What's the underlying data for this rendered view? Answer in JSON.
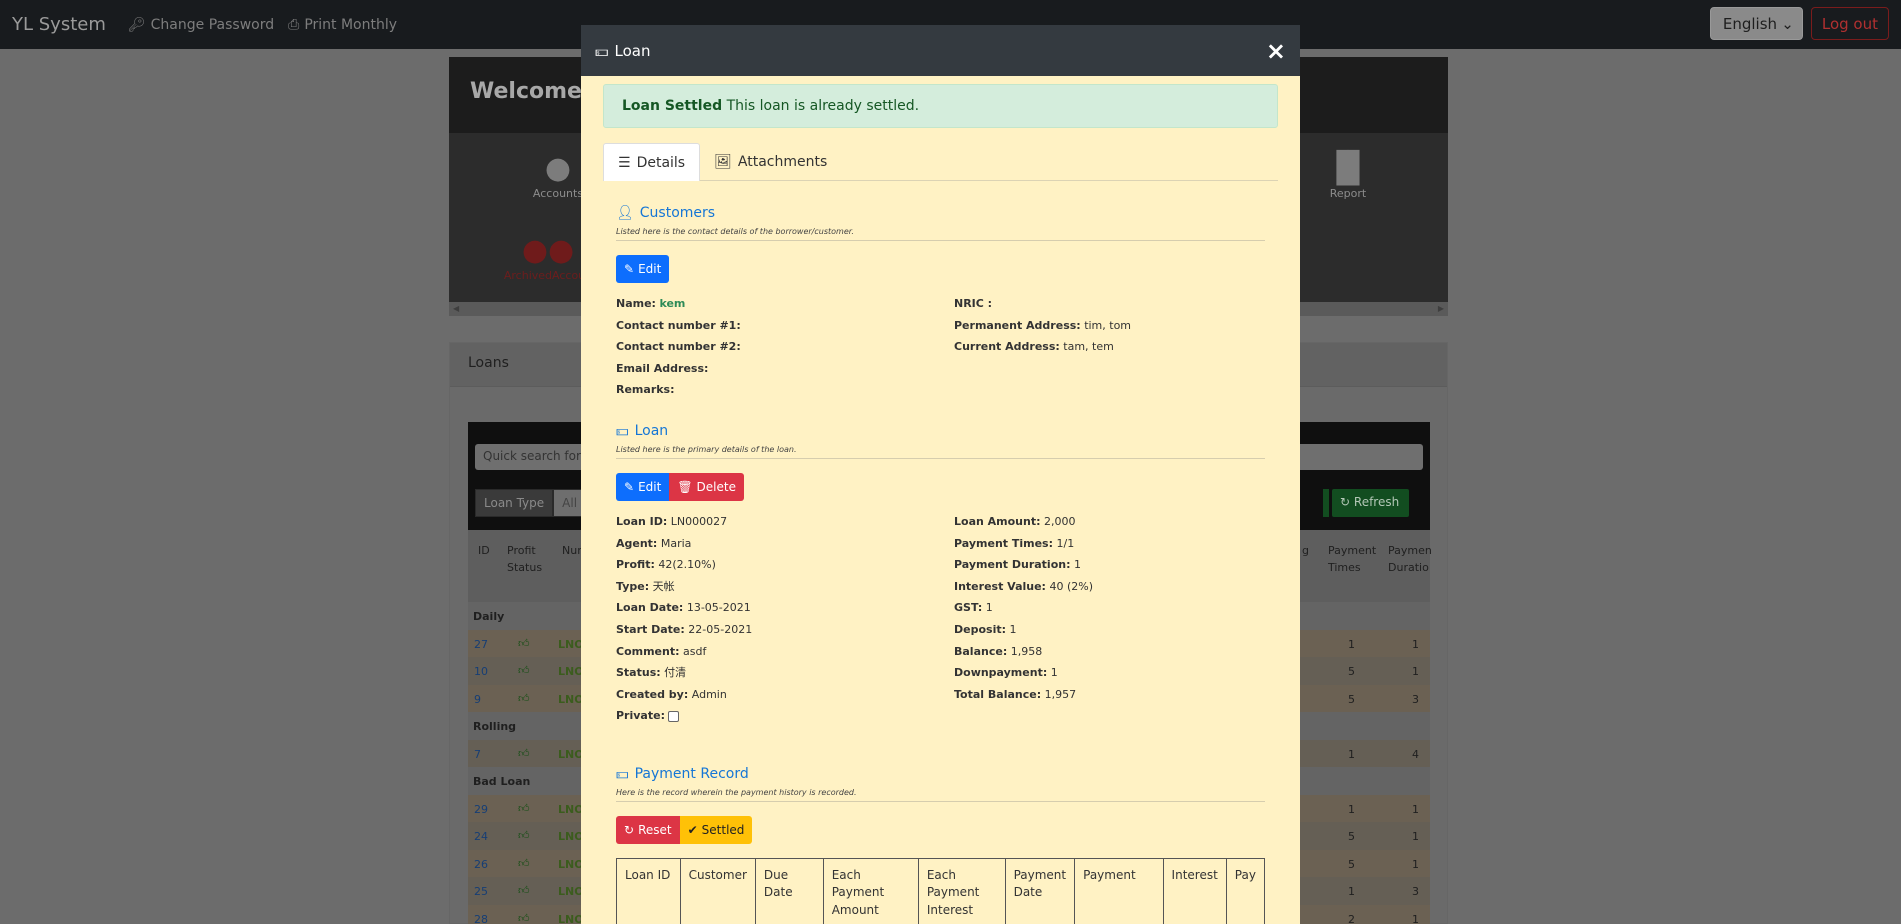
{
  "navbar": {
    "brand": "YL System",
    "change_password": "Change Password",
    "print_monthly": "Print Monthly",
    "language": "English",
    "logout": "Log out"
  },
  "background": {
    "welcome": "Welcome, A",
    "tiles": [
      {
        "label": "Accounts",
        "icon": "user-icon"
      },
      {
        "label": "Report",
        "icon": "bar-chart-icon"
      },
      {
        "label": "ArchivedAccoun",
        "icon": "users-icon"
      }
    ],
    "loans_title": "Loans",
    "quick_search": "Quick search for",
    "loan_type_label": "Loan Type",
    "loan_type_value": "All",
    "refresh": "Refresh",
    "headers": {
      "id": "ID",
      "profit_status_1": "Profit",
      "profit_status_2": "Status",
      "num": "Num",
      "payment_times_1": "Payment",
      "payment_times_2": "Times",
      "payment_duration_1": "Paymen",
      "payment_duration_2": "Duratio",
      "g_1": "g"
    },
    "groups": [
      {
        "name": "Daily",
        "rows": [
          {
            "id": "27",
            "ln": "LNO",
            "c1": "1",
            "c2": "1"
          },
          {
            "id": "10",
            "ln": "LNO",
            "c1": "5",
            "c2": "1"
          },
          {
            "id": "9",
            "ln": "LNO",
            "c1": "5",
            "c2": "3"
          }
        ]
      },
      {
        "name": "Rolling",
        "rows": [
          {
            "id": "7",
            "ln": "LNO",
            "c1": "1",
            "c2": "4"
          }
        ]
      },
      {
        "name": "Bad Loan",
        "rows": [
          {
            "id": "29",
            "ln": "LNO",
            "c1": "1",
            "c2": "1"
          },
          {
            "id": "24",
            "ln": "LNO",
            "c1": "5",
            "c2": "1"
          },
          {
            "id": "26",
            "ln": "LNO",
            "c1": "5",
            "c2": "1"
          },
          {
            "id": "25",
            "ln": "LNO",
            "c1": "1",
            "c2": "3"
          },
          {
            "id": "28",
            "ln": "LNO",
            "c1": "2",
            "c2": "1"
          }
        ]
      }
    ]
  },
  "modal": {
    "title": "Loan",
    "alert_strong": "Loan Settled",
    "alert_text": "This loan is already settled.",
    "tabs": {
      "details": "Details",
      "attachments": "Attachments"
    },
    "customers": {
      "title": "Customers",
      "subtitle": "Listed here is the contact details of the borrower/customer.",
      "edit": "Edit",
      "left": [
        {
          "k": "Name:",
          "v": "kem",
          "green": true
        },
        {
          "k": "Contact number #1:",
          "v": ""
        },
        {
          "k": "Contact number #2:",
          "v": ""
        },
        {
          "k": "Email Address:",
          "v": ""
        },
        {
          "k": "Remarks:",
          "v": ""
        }
      ],
      "right": [
        {
          "k": "NRIC :",
          "v": ""
        },
        {
          "k": "Permanent Address:",
          "v": "tim, tom"
        },
        {
          "k": "Current Address:",
          "v": "tam, tem"
        }
      ]
    },
    "loan": {
      "title": "Loan",
      "subtitle": "Listed here is the primary details of the loan.",
      "edit": "Edit",
      "delete": "Delete",
      "left": [
        {
          "k": "Loan ID:",
          "v": "LN000027"
        },
        {
          "k": "Agent:",
          "v": "Maria"
        },
        {
          "k": "Profit:",
          "v": "42(2.10%)"
        },
        {
          "k": "Type:",
          "v": "天帐"
        },
        {
          "k": "Loan Date:",
          "v": "13-05-2021"
        },
        {
          "k": "Start Date:",
          "v": "22-05-2021"
        },
        {
          "k": "Comment:",
          "v": "asdf"
        },
        {
          "k": "Status:",
          "v": "付清"
        },
        {
          "k": "Created by:",
          "v": "Admin"
        },
        {
          "k": "Private:",
          "v": ""
        }
      ],
      "right": [
        {
          "k": "Loan Amount:",
          "v": "2,000"
        },
        {
          "k": "Payment Times:",
          "v": "1/1"
        },
        {
          "k": "Payment Duration:",
          "v": "1"
        },
        {
          "k": "Interest Value:",
          "v": "40 (2%)"
        },
        {
          "k": "GST:",
          "v": "1"
        },
        {
          "k": "Deposit:",
          "v": "1"
        },
        {
          "k": "Balance:",
          "v": "1,958"
        },
        {
          "k": "Downpayment:",
          "v": "1"
        },
        {
          "k": "Total Balance:",
          "v": "1,957"
        }
      ]
    },
    "payment": {
      "title": "Payment Record",
      "subtitle": "Here is the record wherein the payment history is recorded.",
      "reset": "Reset",
      "settled": "Settled",
      "columns": [
        "Loan ID",
        "Customer",
        "Due Date",
        "Each Payment Amount",
        "Each Payment Interest",
        "Payment Date",
        "Payment",
        "Interest",
        "Pay"
      ]
    }
  }
}
